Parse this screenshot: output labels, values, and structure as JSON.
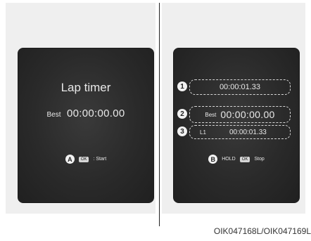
{
  "left_screen": {
    "title": "Lap timer",
    "best_label": "Best",
    "best_time": "00:00:00.00",
    "footer_letter": "A",
    "footer_key": "OK",
    "footer_action": ": Start"
  },
  "right_screen": {
    "items": [
      {
        "number": "1",
        "time": "00:00:01.33"
      },
      {
        "number": "2",
        "label": "Best",
        "time": "00:00:00.00"
      },
      {
        "number": "3",
        "label": "L1",
        "time": "00:00:01.33"
      }
    ],
    "footer_letter": "B",
    "footer_hold": "HOLD",
    "footer_key": "OK",
    "footer_action": "Stop"
  },
  "caption": "OIK047168L/OIK047169L"
}
